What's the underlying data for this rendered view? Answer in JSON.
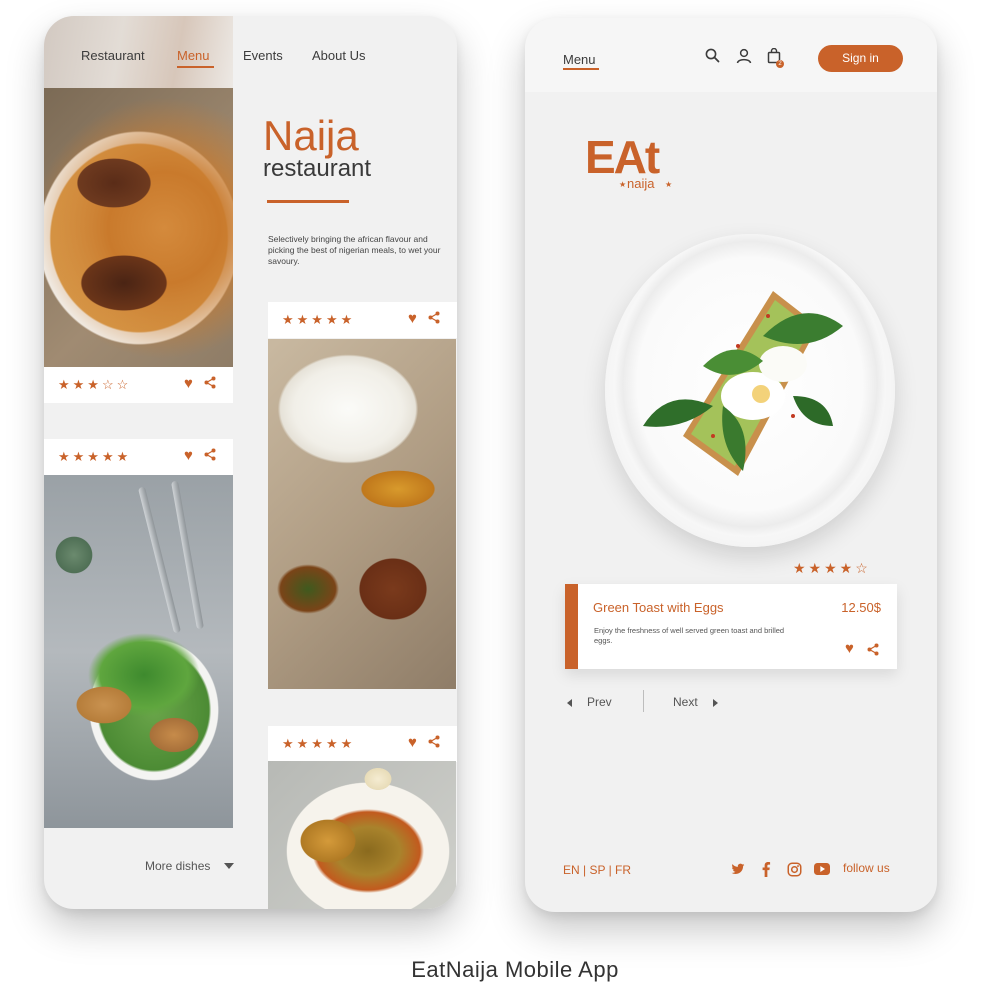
{
  "caption": "EatNaija Mobile App",
  "colors": {
    "accent": "#c9622a",
    "background": "#f1f1f1",
    "text": "#3c3c3c"
  },
  "left_screen": {
    "nav": {
      "items": [
        {
          "label": "Restaurant"
        },
        {
          "label": "Menu",
          "active": true
        },
        {
          "label": "Events"
        },
        {
          "label": "About Us"
        }
      ]
    },
    "hero": {
      "title": "Naija",
      "subtitle": "restaurant",
      "description": "Selectively bringing the african flavour and picking the best of nigerian meals, to wet your savoury."
    },
    "cards": [
      {
        "image": "jollof-rice-chicken",
        "rating": 3,
        "max_rating": 5
      },
      {
        "image": "white-rice-chicken-plantain",
        "rating": 5,
        "max_rating": 5
      },
      {
        "image": "salad-bowl",
        "rating": 5,
        "max_rating": 5
      },
      {
        "image": "egusi-soup",
        "rating": 5,
        "max_rating": 5
      }
    ],
    "more_dishes_label": "More dishes"
  },
  "right_screen": {
    "header": {
      "menu_label": "Menu",
      "icons": [
        "search-icon",
        "user-icon",
        "bag-icon"
      ],
      "cart_count": "2",
      "sign_in_label": "Sign in"
    },
    "logo": {
      "main": "EAt",
      "sub": "naija"
    },
    "featured": {
      "rating": 4,
      "max_rating": 5,
      "name": "Green Toast with Eggs",
      "price": "12.50$",
      "description": "Enjoy the freshness of well served green toast and brilled eggs."
    },
    "pager": {
      "prev_label": "Prev",
      "next_label": "Next"
    },
    "footer": {
      "languages": "EN | SP | FR",
      "social_icons": [
        "twitter-icon",
        "facebook-icon",
        "instagram-icon",
        "youtube-icon"
      ],
      "follow_label": "follow us"
    }
  }
}
